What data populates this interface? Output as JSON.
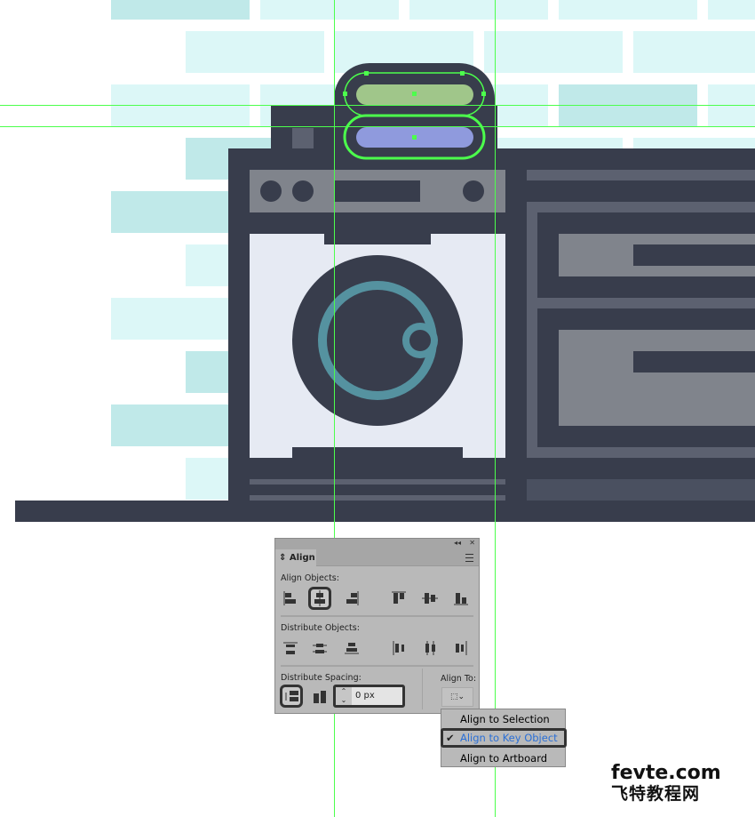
{
  "panel": {
    "title": "Align",
    "align_objects_label": "Align Objects:",
    "distribute_objects_label": "Distribute Objects:",
    "distribute_spacing_label": "Distribute Spacing:",
    "align_to_label": "Align To:",
    "spacing_value": "0 px",
    "collapse_icon": "double-chevron-left",
    "close_icon": "close"
  },
  "dropdown": {
    "items": [
      {
        "label": "Align to Selection",
        "checked": false
      },
      {
        "label": "Align to Key Object",
        "checked": true
      },
      {
        "label": "Align to Artboard",
        "checked": false
      }
    ],
    "check": "✔"
  },
  "watermark": {
    "line1": "fevte.com",
    "line2": "飞特教程网"
  },
  "colors": {
    "accent_selected": "#2a6fd6",
    "guide": "#4cff4c",
    "dark": "#383d4c",
    "teal": "#5592a0",
    "green_pill": "#a0c68a",
    "blue_pill": "#8f9add"
  }
}
